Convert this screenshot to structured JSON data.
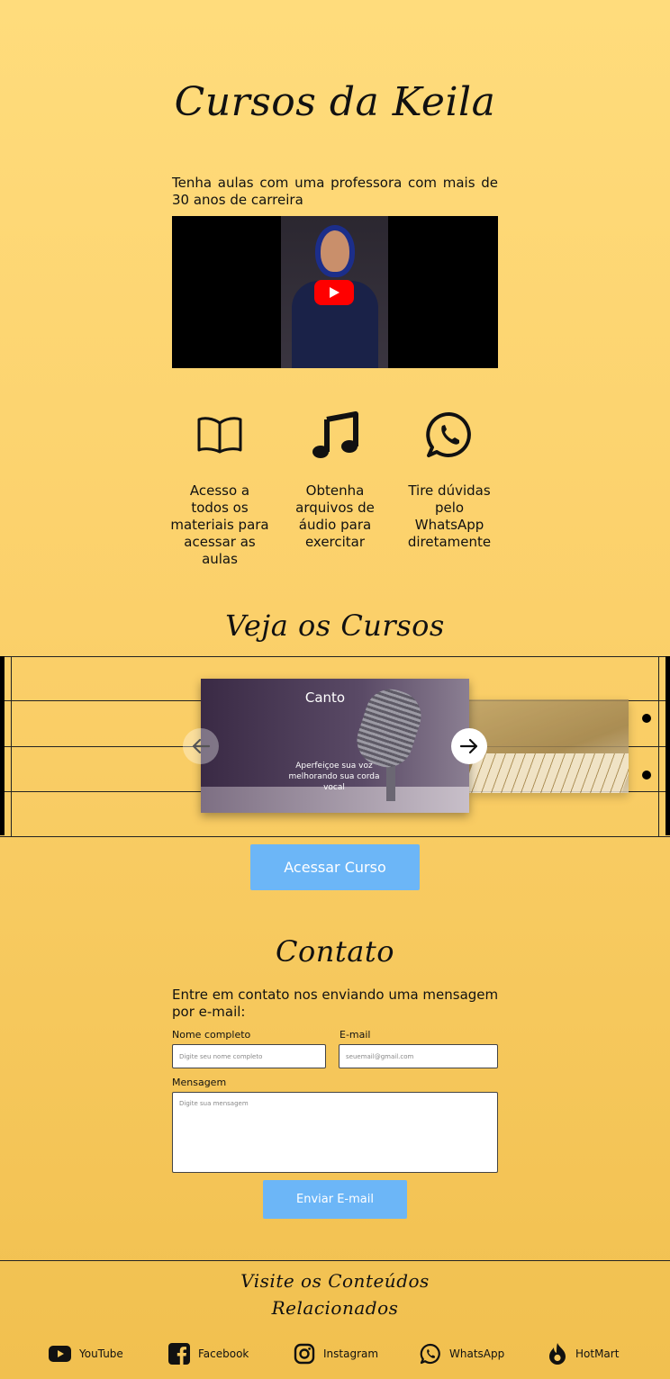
{
  "header": {
    "title": "Cursos da Keila"
  },
  "intro": {
    "text": "Tenha aulas com uma professora com mais de 30 anos de carreira"
  },
  "video": {
    "icon": "youtube-play-icon"
  },
  "features": [
    {
      "icon": "book-icon",
      "text": "Acesso a todos os materiais para acessar as aulas"
    },
    {
      "icon": "music-note-icon",
      "text": "Obtenha arquivos de áudio para exercitar"
    },
    {
      "icon": "whatsapp-icon",
      "text": "Tire dúvidas pelo WhatsApp diretamente"
    }
  ],
  "courses": {
    "title": "Veja os Cursos",
    "current": {
      "name": "Canto",
      "description": "Aperfeiçoe sua voz melhorando sua corda vocal"
    },
    "access_label": "Acessar Curso"
  },
  "contact": {
    "title": "Contato",
    "intro": "Entre em contato nos enviando uma mensagem por e-mail:",
    "name_label": "Nome completo",
    "name_placeholder": "Digite seu nome completo",
    "email_label": "E-mail",
    "email_placeholder": "seuemail@gmail.com",
    "message_label": "Mensagem",
    "message_placeholder": "Digite sua mensagem",
    "send_label": "Enviar E-mail"
  },
  "footer": {
    "title_line1": "Visite os Conteúdos",
    "title_line2": "Relacionados",
    "links": [
      {
        "icon": "youtube-icon",
        "label": "YouTube"
      },
      {
        "icon": "facebook-icon",
        "label": "Facebook"
      },
      {
        "icon": "instagram-icon",
        "label": "Instagram"
      },
      {
        "icon": "whatsapp-icon",
        "label": "WhatsApp"
      },
      {
        "icon": "hotmart-icon",
        "label": "HotMart"
      }
    ]
  },
  "colors": {
    "background": "#fbd06a",
    "button": "#6cb6f7",
    "text": "#111111"
  }
}
